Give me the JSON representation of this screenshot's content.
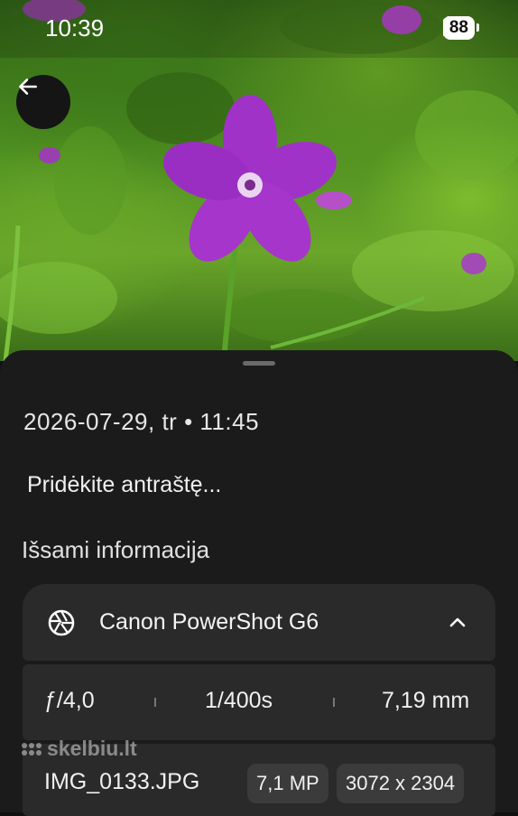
{
  "status_bar": {
    "time": "10:39",
    "battery": "88"
  },
  "header": {
    "back_icon": "arrow-left-icon"
  },
  "details": {
    "date": "2026-07-29, tr",
    "time": "11:45",
    "caption_placeholder": "Pridėkite antraštę...",
    "section_title": "Išsami informacija",
    "camera": {
      "name": "Canon PowerShot G6",
      "icon": "camera-aperture-icon",
      "toggle_icon": "chevron-up-icon"
    },
    "exif": {
      "aperture": "ƒ/4,0",
      "shutter": "1/400s",
      "focal_length": "7,19 mm"
    },
    "file": {
      "name": "IMG_0133.JPG",
      "megapixels": "7,1 MP",
      "resolution": "3072 x 2304"
    }
  },
  "watermark": {
    "text": "skelbiu.lt"
  }
}
